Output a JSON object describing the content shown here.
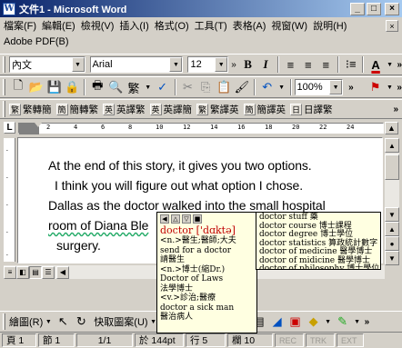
{
  "window": {
    "title": "文件1 - Microsoft Word",
    "app_icon_glyph": "W",
    "minimize_glyph": "_",
    "maximize_glyph": "□",
    "close_glyph": "×"
  },
  "menu": {
    "items": [
      "檔案(F)",
      "編輯(E)",
      "檢視(V)",
      "插入(I)",
      "格式(O)",
      "工具(T)",
      "表格(A)",
      "視窗(W)",
      "說明(H)",
      "Adobe PDF(B)"
    ]
  },
  "formatting_toolbar": {
    "style": "內文",
    "font": "Arial",
    "size": "12",
    "bold": "B",
    "italic": "I",
    "more": "»"
  },
  "standard_toolbar": {
    "zoom": "100%",
    "more": "»"
  },
  "conversion_toolbar": {
    "buttons": [
      {
        "icon": "繁",
        "label": "繁轉簡"
      },
      {
        "icon": "簡",
        "label": "簡轉繁"
      },
      {
        "icon": "英",
        "label": "英譯繁"
      },
      {
        "icon": "英",
        "label": "英譯簡"
      },
      {
        "icon": "繁",
        "label": "繁譯英"
      },
      {
        "icon": "簡",
        "label": "簡譯英"
      },
      {
        "icon": "日",
        "label": "日譯繁"
      }
    ]
  },
  "ruler": {
    "corner_glyph": "L",
    "ticks": [
      "2",
      "4",
      "6",
      "8",
      "10",
      "12",
      "14",
      "16",
      "18",
      "20",
      "22",
      "24"
    ]
  },
  "document": {
    "lines": [
      "At the end of this story, it gives you two options.",
      "I think you will figure out what option I chose.",
      "Dallas as the doctor walked into the small hospital",
      "room of Diana Ble",
      "surgery."
    ]
  },
  "dictionary_popup": {
    "word": "doctor ['dɑktə]",
    "definitions": [
      "<n.>醫生;醫師;大夫",
      "send for a doctor",
      "請醫生",
      "<n.>博士(縮Dr.)",
      "Doctor of Laws",
      "法學博士",
      "<v.>診治;醫療",
      "doctor a sick man",
      "醫治病人"
    ]
  },
  "phrase_popup": {
    "phrases": [
      "doctor stuff 藥",
      "doctor course 博士課程",
      "doctor degree 博士學位",
      "doctor statistics 算政統計數字",
      "doctor of medicine 醫學博士",
      "doctor of midicine 醫學博士",
      "doctor of philosophy 博士學位"
    ]
  },
  "drawing_toolbar": {
    "draw_label": "繪圖(R)",
    "autoshapes_label": "快取圖案(U)",
    "more": "»"
  },
  "status_bar": {
    "page": "頁 1",
    "section": "節 1",
    "page_of": "1/1",
    "position": "於 144pt",
    "line": "行 5",
    "column": "欄 10",
    "rec": "REC",
    "trk": "TRK",
    "ext": "EXT"
  }
}
